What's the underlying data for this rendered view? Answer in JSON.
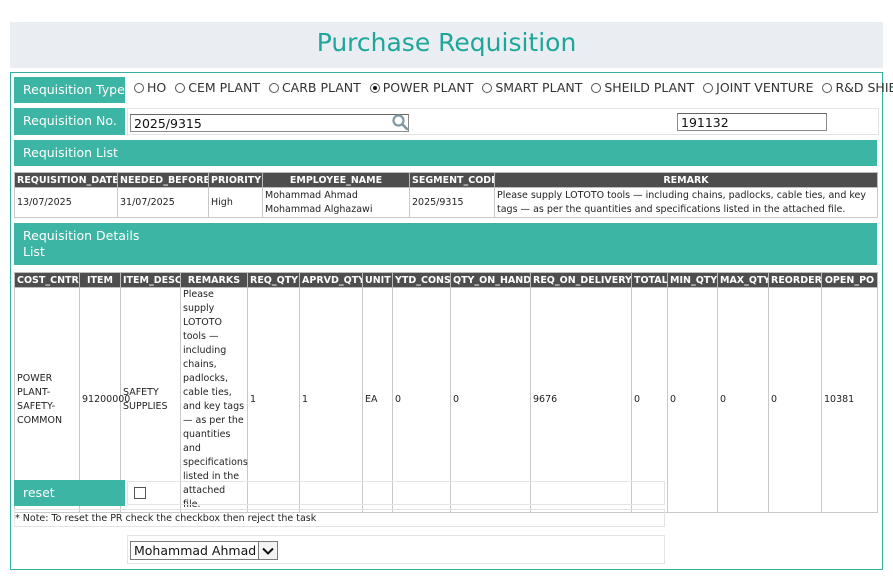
{
  "page": {
    "title": "Purchase Requisition"
  },
  "requisition_type": {
    "label": "Requisition Type",
    "options": [
      {
        "label": "HO",
        "checked": false
      },
      {
        "label": "CEM PLANT",
        "checked": false
      },
      {
        "label": "CARB PLANT",
        "checked": false
      },
      {
        "label": "POWER PLANT",
        "checked": true
      },
      {
        "label": "SMART PLANT",
        "checked": false
      },
      {
        "label": "SHEILD PLANT",
        "checked": false
      },
      {
        "label": "JOINT VENTURE",
        "checked": false
      },
      {
        "label": "R&D SHIELD",
        "checked": false
      }
    ]
  },
  "requisition_no": {
    "label": "Requisition No.",
    "value": "2025/9315",
    "secondary_value": "191132"
  },
  "requisition_list": {
    "label": "Requisition List",
    "columns": [
      "REQUISITION_DATE",
      "NEEDED_BEFORE",
      "PRIORITY",
      "EMPLOYEE_NAME",
      "SEGMENT_CODE",
      "REMARK"
    ],
    "rows": [
      [
        "13/07/2025",
        "31/07/2025",
        "High",
        "Mohammad Ahmad Mohammad Alghazawi",
        "2025/9315",
        "Please supply LOTOTO tools — including chains, padlocks, cable ties, and key tags — as per the quantities and specifications listed in the attached file."
      ]
    ]
  },
  "details_list": {
    "label": "Requisition Details List",
    "columns": [
      "COST_CNTR",
      "ITEM",
      "ITEM_DESC",
      "REMARKS",
      "REQ_QTY",
      "APRVD_QTY",
      "UNIT",
      "YTD_CONS",
      "QTY_ON_HAND",
      "REQ_ON_DELIVERY",
      "TOTAL",
      "MIN_QTY",
      "MAX_QTY",
      "REORDER",
      "OPEN_PO"
    ],
    "rows": [
      [
        "POWER PLANT-SAFETY-COMMON",
        "91200000",
        "SAFETY SUPPLIES",
        "Please supply LOTOTO tools — including chains, padlocks, cable ties, and key tags — as per the quantities and specifications listed in the attached file.",
        "1",
        "1",
        "EA",
        "0",
        "0",
        "9676",
        "0",
        "0",
        "0",
        "0",
        "10381"
      ]
    ]
  },
  "reset": {
    "label": "reset",
    "checked": false,
    "note": "* Note: To reset the PR check the checkbox then reject the task"
  },
  "employee_select": {
    "value": "Mohammad Ahmad M"
  },
  "colors": {
    "accent": "#3db5a4",
    "title": "#1fa69b",
    "header_bg": "#4e4e4e"
  },
  "icons": {
    "search": "search-icon",
    "dropdown": "chevron-down-icon"
  }
}
